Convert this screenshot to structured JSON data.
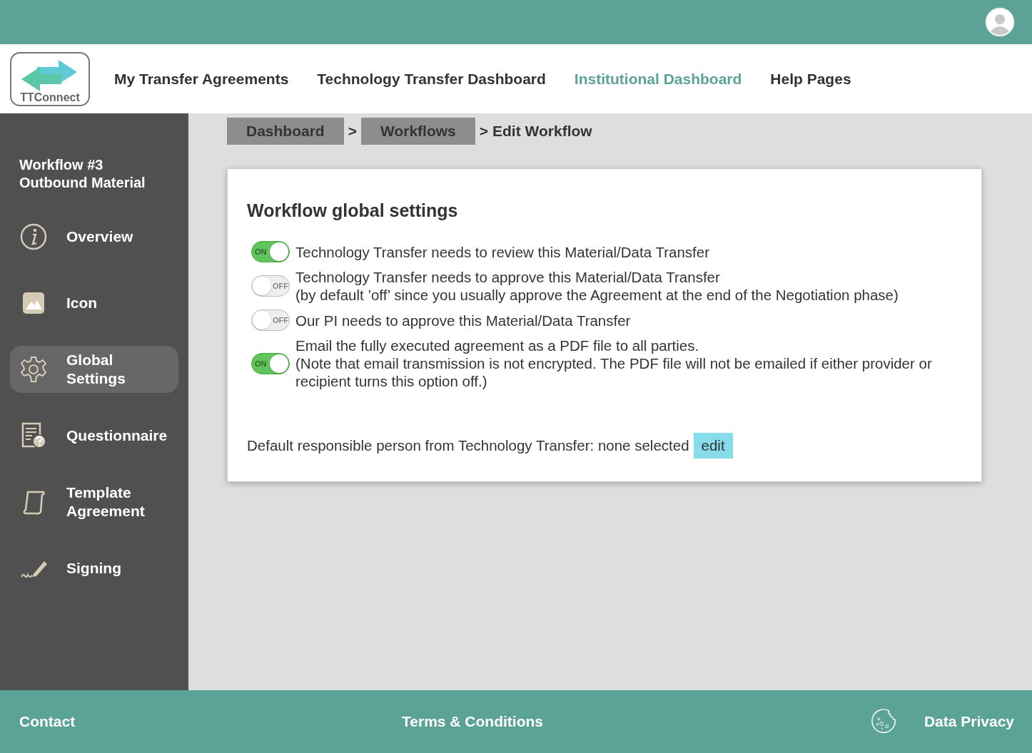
{
  "logo": {
    "text": "TTConnect"
  },
  "nav": [
    {
      "label": "My Transfer Agreements",
      "selected": false
    },
    {
      "label": "Technology Transfer Dashboard",
      "selected": false
    },
    {
      "label": "Institutional Dashboard",
      "selected": true
    },
    {
      "label": "Help Pages",
      "selected": false
    }
  ],
  "sidebar": {
    "title": [
      "Workflow #3",
      "Outbound Material"
    ],
    "items": [
      {
        "label": "Overview",
        "selected": false
      },
      {
        "label": "Icon",
        "selected": false
      },
      {
        "label": "Global Settings",
        "selected": true
      },
      {
        "label": "Questionnaire",
        "selected": false
      },
      {
        "label": "Template Agreement",
        "selected": false
      },
      {
        "label": "Signing",
        "selected": false
      }
    ]
  },
  "breadcrumb": {
    "links": [
      "Dashboard",
      "Workflows"
    ],
    "separators": [
      ">",
      ">"
    ],
    "current": "Edit Workflow"
  },
  "settings": {
    "title": "Workflow global settings",
    "options": [
      {
        "on": true,
        "switch_text": "ON",
        "lines": [
          "Technology Transfer needs to review this Material/Data Transfer"
        ]
      },
      {
        "on": false,
        "switch_text": "OFF",
        "lines": [
          "Technology Transfer needs to approve this Material/Data Transfer",
          "(by default ’off’ since you usually approve the Agreement at the end of the Negotiation phase)"
        ]
      },
      {
        "on": false,
        "switch_text": "OFF",
        "lines": [
          "Our PI needs to approve this Material/Data Transfer"
        ]
      },
      {
        "on": true,
        "switch_text": "ON",
        "lines": [
          "Email the fully executed agreement as a PDF file to all parties.",
          "(Note that email transmission is not encrypted. The PDF file will not be emailed if either provider or recipient turns this option off.)"
        ]
      }
    ],
    "responsible": {
      "text": "Default responsible person from Technology Transfer: none selected",
      "button": "edit"
    }
  },
  "footer": {
    "contact": "Contact",
    "terms": "Terms & Conditions",
    "privacy": "Data Privacy"
  }
}
